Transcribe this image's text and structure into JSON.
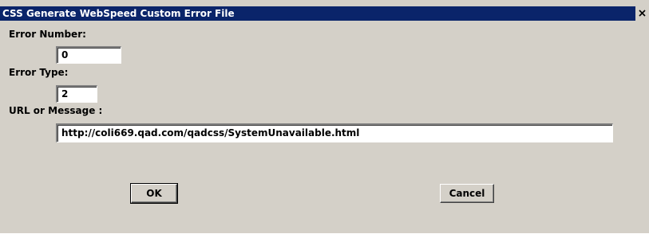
{
  "window": {
    "title": "CSS Generate WebSpeed Custom Error File",
    "close_icon": "close-icon"
  },
  "form": {
    "error_number": {
      "label": "Error Number:",
      "value": "0"
    },
    "error_type": {
      "label": "Error Type:",
      "value": "2"
    },
    "url_or_message": {
      "label": "URL or Message :",
      "value": "http://coli669.qad.com/qadcss/SystemUnavailable.html"
    }
  },
  "buttons": {
    "ok_label": "OK",
    "cancel_label": "Cancel"
  },
  "colors": {
    "titlebar": "#0a246a",
    "window_bg": "#d4d0c8"
  }
}
